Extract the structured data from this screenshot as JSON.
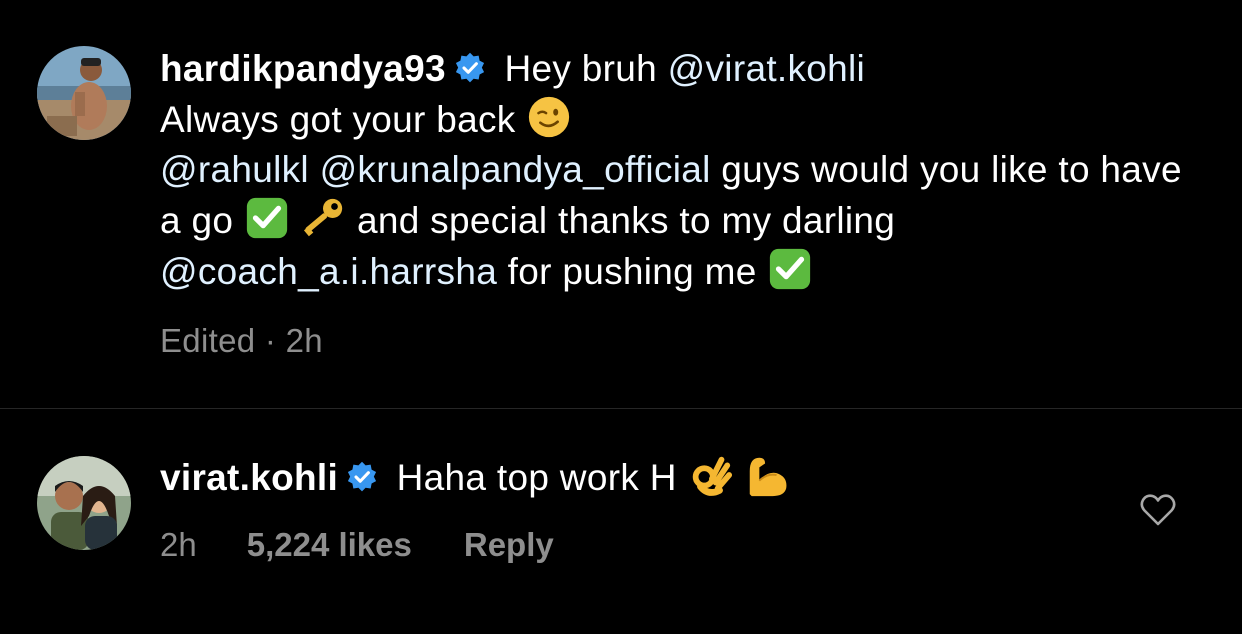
{
  "caption": {
    "username": "hardikpandya93",
    "intro_text": " Hey bruh ",
    "mention_virat": "@virat.kohli",
    "line2_text": "Always got your back ",
    "mention_rahul": "@rahulkl",
    "mention_krunal": "@krunalpandya_official",
    "line3_text": " guys would you like to have a go ",
    "line4_text": " and special thanks to my darling ",
    "mention_coach": "@coach_a.i.harrsha",
    "line5_text": "  for pushing me ",
    "edited_label": "Edited",
    "separator": " · ",
    "time": "2h",
    "emojis": [
      "winking-face",
      "check-mark-button",
      "key",
      "check-mark-button"
    ]
  },
  "comment": {
    "username": "virat.kohli",
    "text": " Haha top work H ",
    "emojis": [
      "ok-hand",
      "flexed-biceps"
    ],
    "time": "2h",
    "likes": "5,224 likes",
    "reply_label": "Reply"
  },
  "colors": {
    "background": "#000000",
    "text": "#ffffff",
    "secondary": "#8e8e8e",
    "mention": "#e0f1ff",
    "verified": "#3897f0",
    "divider": "#262626"
  }
}
